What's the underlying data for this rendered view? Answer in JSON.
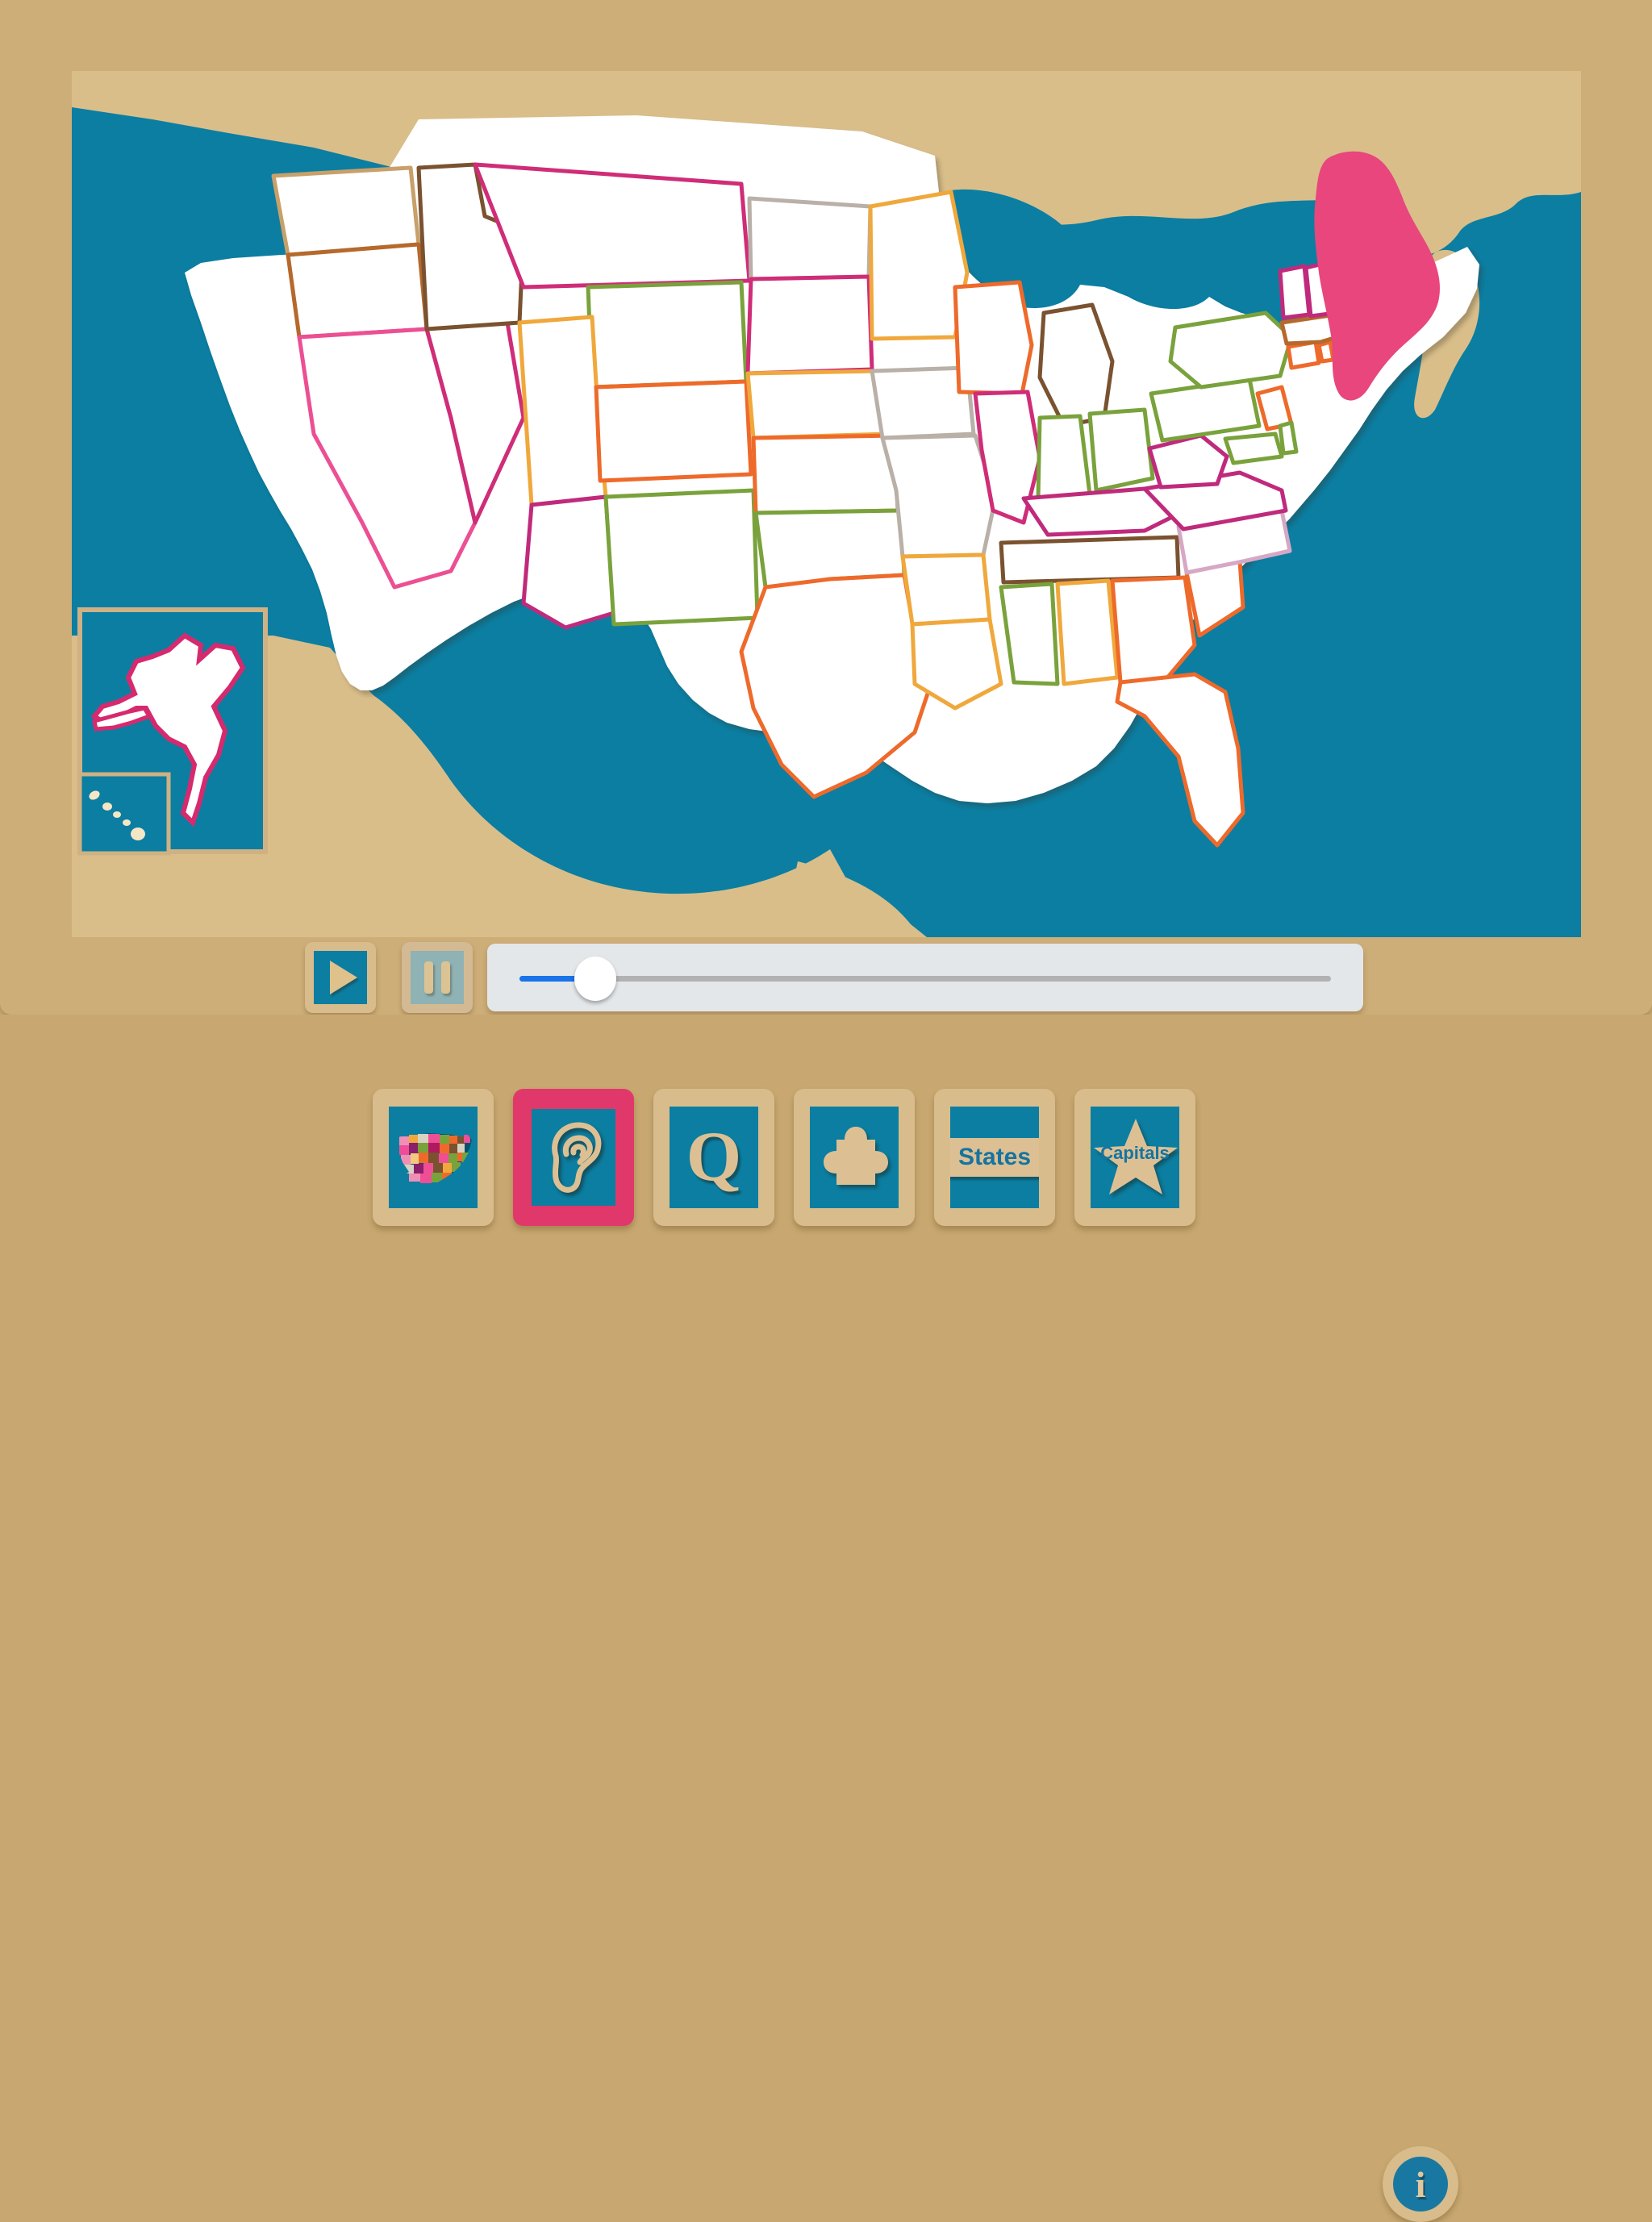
{
  "app": {
    "background_color": "#c8a870",
    "panel_color": "#cdae78",
    "ocean_color": "#0b7ea2",
    "land_color": "#d9be8a",
    "accent_selected": "#e1386b",
    "state_fill": "#ffffff",
    "highlight_state": "Maine",
    "highlight_color": "#e8467d"
  },
  "map": {
    "name": "united-states-map",
    "ocean_color": "#0b7ea2",
    "land_color": "#d9be8a",
    "insets": [
      "Alaska",
      "Hawaii"
    ],
    "highlighted_states": [
      "Maine"
    ]
  },
  "transport": {
    "play_label": "Play",
    "pause_label": "Pause",
    "play_enabled": true,
    "pause_enabled": false,
    "slider": {
      "value": 8,
      "min": 0,
      "max": 100,
      "fill_color": "#1a73e8",
      "track_color": "#b2b2b2"
    }
  },
  "toolbar": {
    "buttons": [
      {
        "name": "map-mode",
        "icon": "usa-map-icon",
        "label": "",
        "selected": false
      },
      {
        "name": "listen-mode",
        "icon": "ear-icon",
        "label": "",
        "selected": true
      },
      {
        "name": "quiz-mode",
        "icon": "q-letter-icon",
        "label": "Q",
        "selected": false
      },
      {
        "name": "puzzle-mode",
        "icon": "puzzle-piece-icon",
        "label": "",
        "selected": false
      },
      {
        "name": "states-mode",
        "icon": "states-plate-icon",
        "label": "States",
        "selected": false
      },
      {
        "name": "capitals-mode",
        "icon": "star-icon",
        "label": "Capitals",
        "selected": false
      }
    ],
    "info_label": "i",
    "info_name": "info-icon"
  }
}
